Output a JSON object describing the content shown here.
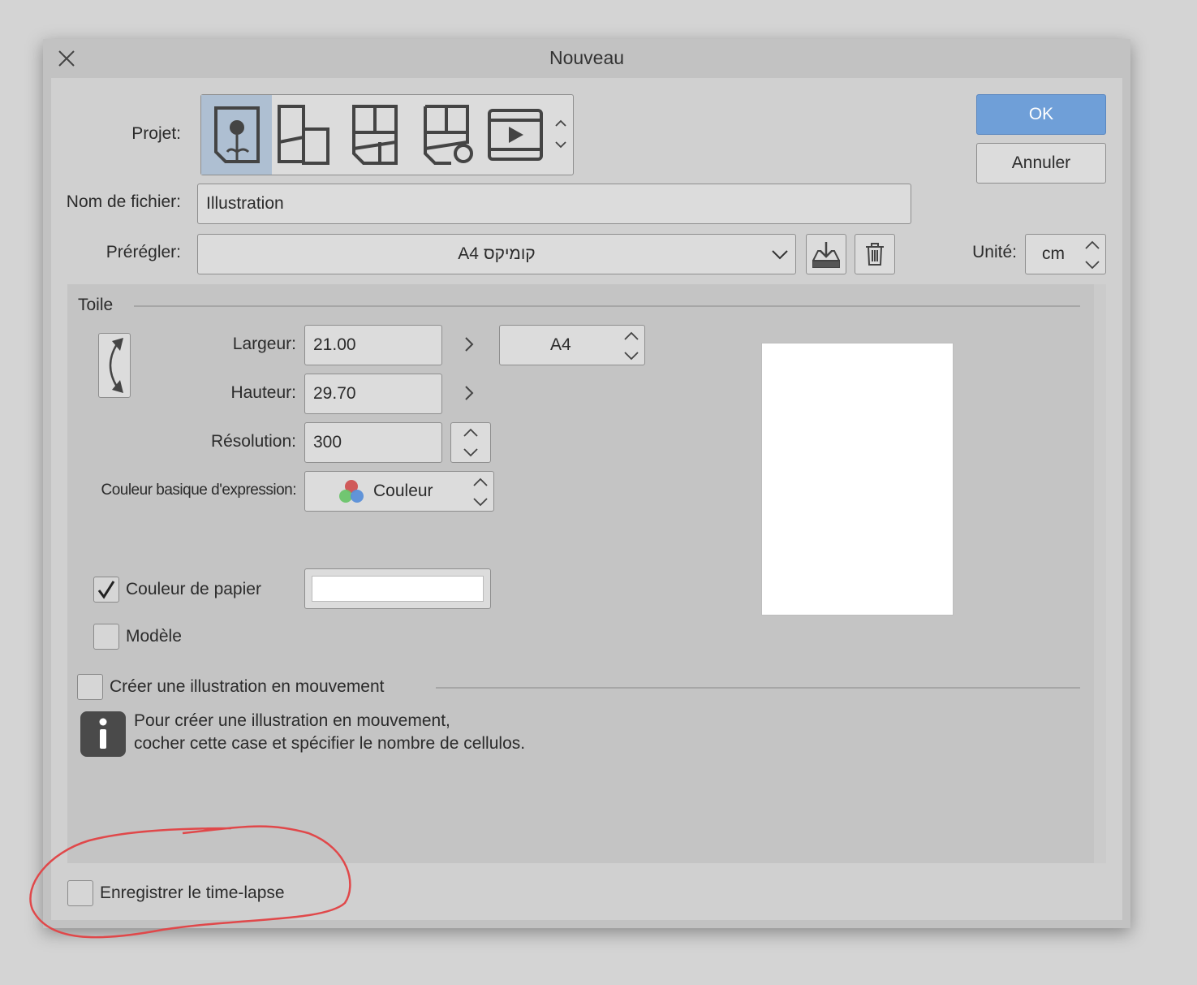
{
  "title": "Nouveau",
  "project": {
    "label": "Projet:",
    "types": [
      "illustration",
      "comic",
      "multi-page-comic",
      "multi-page-comic-settings",
      "animation"
    ],
    "selected": 0
  },
  "filename": {
    "label": "Nom de fichier:",
    "value": "Illustration"
  },
  "preset": {
    "label": "Prérégler:",
    "value": "A4 קומיקס"
  },
  "unit": {
    "label": "Unité:",
    "value": "cm"
  },
  "buttons": {
    "ok": "OK",
    "cancel": "Annuler"
  },
  "canvas": {
    "section": "Toile",
    "width_label": "Largeur:",
    "width": "21.00",
    "height_label": "Hauteur:",
    "height": "29.70",
    "size_preset": "A4",
    "resolution_label": "Résolution:",
    "resolution": "300",
    "color_label": "Couleur basique d'expression:",
    "color_value": "Couleur",
    "paper_color_label": "Couleur de papier",
    "paper_color_checked": true,
    "paper_color": "#ffffff",
    "template_label": "Modèle",
    "template_checked": false
  },
  "animation": {
    "label": "Créer une illustration en mouvement",
    "checked": false,
    "info_line1": "Pour créer une illustration en mouvement,",
    "info_line2": "cocher cette case et spécifier le nombre de cellulos."
  },
  "timelapse": {
    "label": "Enregistrer le time-lapse",
    "checked": false
  },
  "colors": {
    "accent": "#6f9fd8",
    "annotation": "#e0484a"
  }
}
